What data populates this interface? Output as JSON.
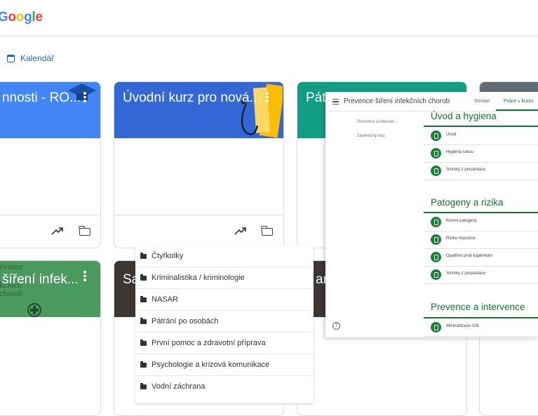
{
  "header": {
    "logo": [
      "G",
      "o",
      "o",
      "g",
      "l",
      "e"
    ]
  },
  "calendar_label": "Kalendář",
  "cards": [
    {
      "title": "nnosti - RO...",
      "color": "#4285f4"
    },
    {
      "title": "Úvodní kurz pro nová...",
      "color": "#3367d6"
    },
    {
      "title": "Pátr",
      "color": "#129e84"
    },
    {
      "title": "",
      "color": "#5f6c72"
    },
    {
      "title": "šíření infek...",
      "color": "#4a9a60",
      "subtitle": [
        "evence",
        "kčních",
        "chorob"
      ]
    },
    {
      "title": "Sa",
      "color": "#3d3633"
    },
    {
      "title": "ar",
      "color": "#3d3633"
    }
  ],
  "folder_menu": [
    "Čtyřkolky",
    "Kriminalistika / kriminologie",
    "NASAR",
    "Pátrání po osobách",
    "První pomoc a zdravotní příprava",
    "Psychologie a krizová komunikace",
    "Vodní záchrana"
  ],
  "classroom": {
    "title": "Prevence šíření infekčních chorob",
    "tabs": [
      "Stream",
      "Práce v kurzu"
    ],
    "left_topics": [
      "Prevence a interven...",
      "Závěrečný test"
    ],
    "sections": [
      {
        "title": "Úvod a hygiena",
        "items": [
          "Úvod",
          "Hygiena rukou",
          "Snímky z prezentace"
        ]
      },
      {
        "title": "Patogeny a rizika",
        "items": [
          "Krevní patogeny",
          "Riziko expozice",
          "Opatření proti kapénkám",
          "Snímky z prezentace"
        ]
      },
      {
        "title": "Prevence a intervence",
        "items": [
          "Minimalizace rizik"
        ]
      }
    ],
    "help_icon": "?"
  }
}
